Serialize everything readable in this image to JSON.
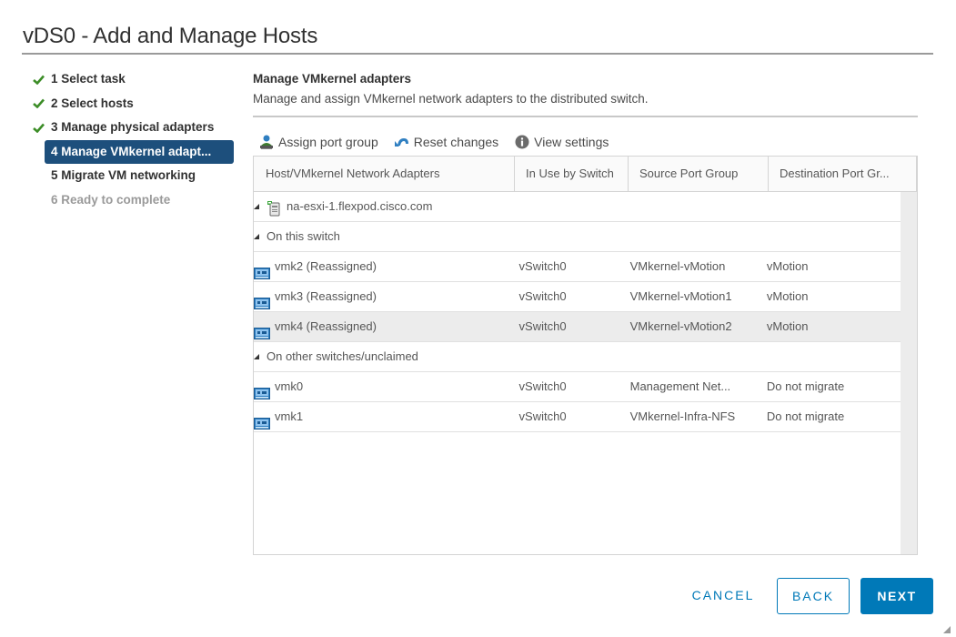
{
  "dialog": {
    "title": "vDS0 - Add and Manage Hosts"
  },
  "steps": [
    {
      "label": "1 Select task",
      "state": "done"
    },
    {
      "label": "2 Select hosts",
      "state": "done"
    },
    {
      "label": "3 Manage physical adapters",
      "state": "done"
    },
    {
      "label": "4 Manage VMkernel adapt...",
      "state": "active"
    },
    {
      "label": "5 Migrate VM networking",
      "state": "pending"
    },
    {
      "label": "6 Ready to complete",
      "state": "disabled"
    }
  ],
  "section": {
    "title": "Manage VMkernel adapters",
    "description": "Manage and assign VMkernel network adapters to the distributed switch."
  },
  "toolbar": {
    "assign_label": "Assign port group",
    "assign_icon": "assign-port-group-icon",
    "reset_label": "Reset changes",
    "reset_icon": "undo-icon",
    "view_label": "View settings",
    "view_icon": "info-icon"
  },
  "grid": {
    "columns": [
      "Host/VMkernel Network Adapters",
      "In Use by Switch",
      "Source Port Group",
      "Destination Port Gr..."
    ],
    "host": "na-esxi-1.flexpod.cisco.com",
    "group_on_switch": "On this switch",
    "group_other": "On other switches/unclaimed",
    "rows_on_switch": [
      {
        "adapter": "vmk2 (Reassigned)",
        "switch": "vSwitch0",
        "source": "VMkernel-vMotion",
        "destination": "vMotion",
        "selected": false
      },
      {
        "adapter": "vmk3 (Reassigned)",
        "switch": "vSwitch0",
        "source": "VMkernel-vMotion1",
        "destination": "vMotion",
        "selected": false
      },
      {
        "adapter": "vmk4 (Reassigned)",
        "switch": "vSwitch0",
        "source": "VMkernel-vMotion2",
        "destination": "vMotion",
        "selected": true
      }
    ],
    "rows_other": [
      {
        "adapter": "vmk0",
        "switch": "vSwitch0",
        "source": "Management Net...",
        "destination": "Do not migrate"
      },
      {
        "adapter": "vmk1",
        "switch": "vSwitch0",
        "source": "VMkernel-Infra-NFS",
        "destination": "Do not migrate"
      }
    ]
  },
  "footer": {
    "cancel": "CANCEL",
    "back": "BACK",
    "next": "NEXT"
  },
  "colors": {
    "primary": "#0079b8",
    "active_step": "#1d4f7c",
    "check": "#3c8d27",
    "selected_row": "#ececec"
  }
}
